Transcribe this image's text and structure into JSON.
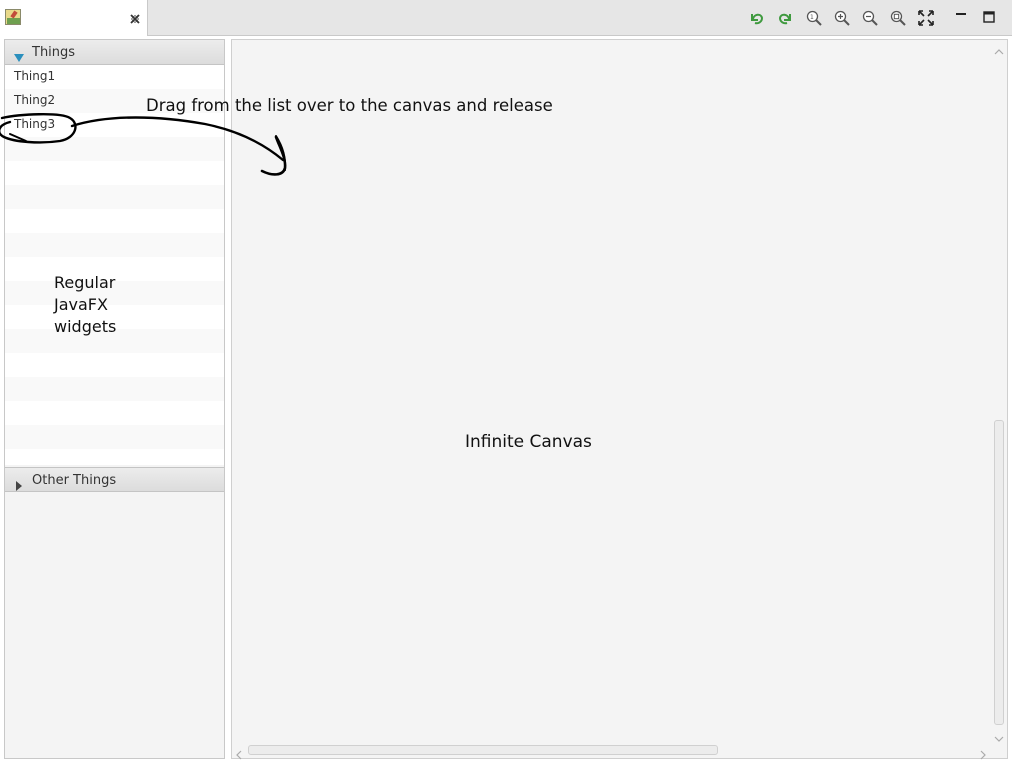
{
  "window": {
    "tab_label": "",
    "tab_icon": "image-editor-icon",
    "toolbar": [
      {
        "name": "undo-button",
        "icon": "undo-icon"
      },
      {
        "name": "redo-button",
        "icon": "redo-icon"
      },
      {
        "name": "zoom-reset-button",
        "icon": "zoom-reset-icon"
      },
      {
        "name": "zoom-in-button",
        "icon": "zoom-in-icon"
      },
      {
        "name": "zoom-out-button",
        "icon": "zoom-out-icon"
      },
      {
        "name": "zoom-fit-button",
        "icon": "zoom-fit-icon"
      },
      {
        "name": "fit-content-button",
        "icon": "fit-content-icon"
      }
    ]
  },
  "palette": {
    "sections": [
      {
        "title": "Things",
        "expanded": true,
        "items": [
          "Thing1",
          "Thing2",
          "Thing3"
        ]
      },
      {
        "title": "Other Things",
        "expanded": false,
        "items": []
      }
    ]
  },
  "annotations": {
    "drag_hint": "Drag from the list over to the canvas and release",
    "widgets_note": [
      "Regular",
      "JavaFX",
      "widgets"
    ],
    "canvas_note": "Infinite Canvas"
  },
  "colors": {
    "accent": "#2a8fbd",
    "undo_green": "#3f9a3f"
  }
}
